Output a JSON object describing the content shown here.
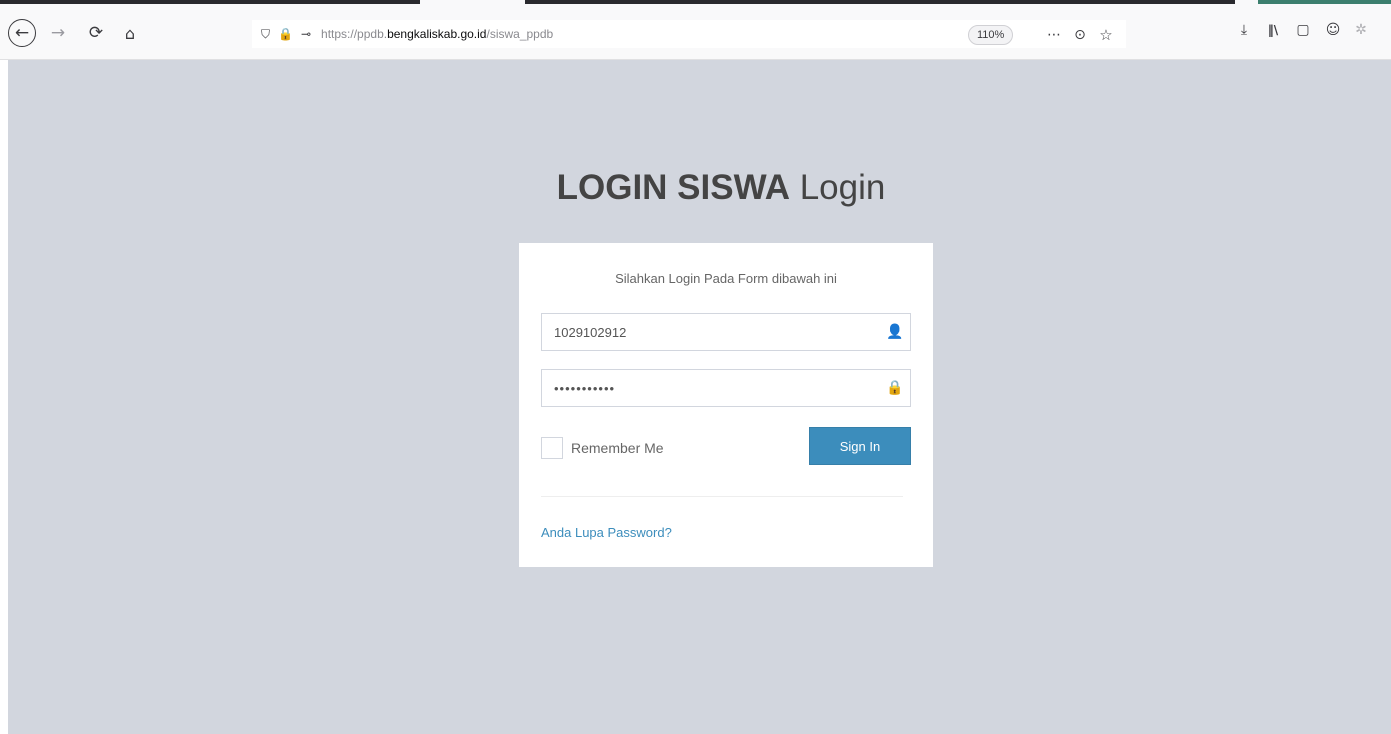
{
  "browser": {
    "url_prefix": "https://ppdb.",
    "url_host": "bengkaliskab.go.id",
    "url_path": "/siswa_ppdb",
    "zoom": "110%"
  },
  "icons": {
    "back": "←",
    "forward": "→",
    "reload": "⟳",
    "home": "⌂",
    "shield": "⛉",
    "lock": "🔒",
    "key": "⊸",
    "page_actions": "⋯",
    "pocket": "⊙",
    "bookmark": "☆",
    "download": "⤓",
    "library": "‖\\",
    "sidebar": "▢",
    "account": "☺",
    "extension": "✲",
    "user": "👤",
    "password_lock": "🔒"
  },
  "login": {
    "title_bold": "LOGIN SISWA",
    "title_rest": " Login",
    "message": "Silahkan Login Pada Form dibawah ini",
    "username_value": "1029102912",
    "password_value": "•••••••••••",
    "remember_label": "Remember Me",
    "signin_label": "Sign In",
    "forgot_link": "Anda Lupa Password?"
  },
  "colors": {
    "page_background": "#d2d6de",
    "primary_button": "#3c8dbc",
    "link": "#3c8dbc"
  }
}
